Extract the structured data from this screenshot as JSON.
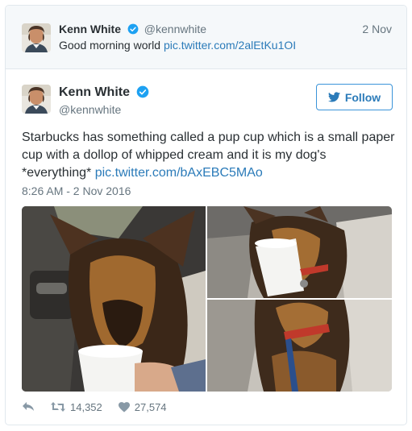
{
  "parent_tweet": {
    "display_name": "Kenn White",
    "handle": "@kennwhite",
    "date": "2 Nov",
    "text": "Good morning world ",
    "link": "pic.twitter.com/2alEtKu1OI"
  },
  "main_tweet": {
    "display_name": "Kenn White",
    "handle": "@kennwhite",
    "follow_label": "Follow",
    "text": "Starbucks has something called a pup cup which is a small paper cup with a dollop of whipped cream and it is my dog's *everything* ",
    "link": "pic.twitter.com/bAxEBC5MAo",
    "timestamp": "8:26 AM - 2 Nov 2016",
    "retweets": "14,352",
    "likes": "27,574"
  },
  "icons": [
    "verified-badge-icon",
    "twitter-bird-icon",
    "reply-icon",
    "retweet-icon",
    "heart-icon"
  ],
  "colors": {
    "link": "#2b7bb9",
    "verified": "#1da1f2",
    "muted": "#66757f",
    "text": "#292f33",
    "parent_bg": "#f5f8fa",
    "border": "#e1e8ed"
  }
}
